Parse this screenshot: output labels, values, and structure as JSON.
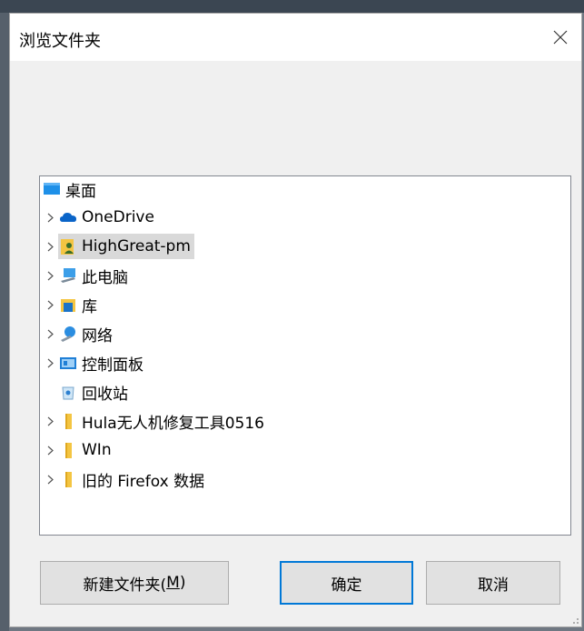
{
  "dialog": {
    "title": "浏览文件夹"
  },
  "tree": {
    "root_label": "桌面",
    "items": [
      {
        "label": "OneDrive",
        "icon": "cloud-icon",
        "expandable": true
      },
      {
        "label": "HighGreat-pm",
        "icon": "user-folder-icon",
        "expandable": true,
        "selected": true
      },
      {
        "label": "此电脑",
        "icon": "computer-icon",
        "expandable": true
      },
      {
        "label": "库",
        "icon": "library-icon",
        "expandable": true
      },
      {
        "label": "网络",
        "icon": "network-icon",
        "expandable": true
      },
      {
        "label": "控制面板",
        "icon": "control-panel-icon",
        "expandable": true
      },
      {
        "label": "回收站",
        "icon": "recycle-bin-icon",
        "expandable": false
      },
      {
        "label": "Hula无人机修复工具0516",
        "icon": "folder-icon",
        "expandable": true
      },
      {
        "label": "WIn",
        "icon": "folder-icon",
        "expandable": true
      },
      {
        "label": "旧的 Firefox 数据",
        "icon": "folder-icon",
        "expandable": true
      }
    ]
  },
  "buttons": {
    "new_folder_prefix": "新建文件夹(",
    "new_folder_mnemonic": "M",
    "new_folder_suffix": ")",
    "ok": "确定",
    "cancel": "取消"
  },
  "colors": {
    "accent": "#0078d7",
    "folder": "#f4c542",
    "selection": "#d9d9d9"
  }
}
